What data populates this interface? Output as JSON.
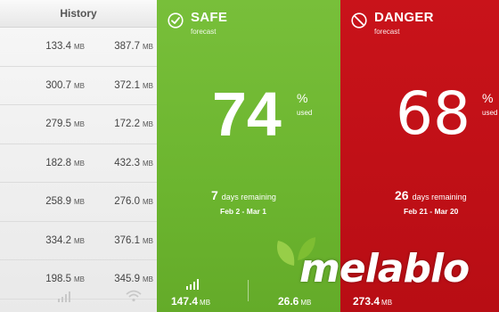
{
  "history": {
    "title": "History",
    "unit": "MB",
    "rows": [
      {
        "a": "133.4",
        "b": "387.7"
      },
      {
        "a": "300.7",
        "b": "372.1"
      },
      {
        "a": "279.5",
        "b": "172.2"
      },
      {
        "a": "182.8",
        "b": "432.3"
      },
      {
        "a": "258.9",
        "b": "276.0"
      },
      {
        "a": "334.2",
        "b": "376.1"
      },
      {
        "a": "198.5",
        "b": "345.9"
      }
    ],
    "footer_icons": [
      "signal-bars-icon",
      "wifi-icon"
    ]
  },
  "safe": {
    "title": "SAFE",
    "subtitle": "forecast",
    "percent": "74",
    "percent_sign": "%",
    "used": "used",
    "days": "7",
    "days_label": "days remaining",
    "range": "Feb 2 - Mar 1",
    "cell": "147.4",
    "wifi": "26.6",
    "unit": "MB",
    "color": "#6cb52f"
  },
  "danger": {
    "title": "DANGER",
    "subtitle": "forecast",
    "percent": "68",
    "percent_sign": "%",
    "used": "used",
    "days": "26",
    "days_label": "days remaining",
    "range": "Feb 21 - Mar 20",
    "cell": "273.4",
    "unit": "MB",
    "color": "#c9131a"
  },
  "watermark": "melablo"
}
